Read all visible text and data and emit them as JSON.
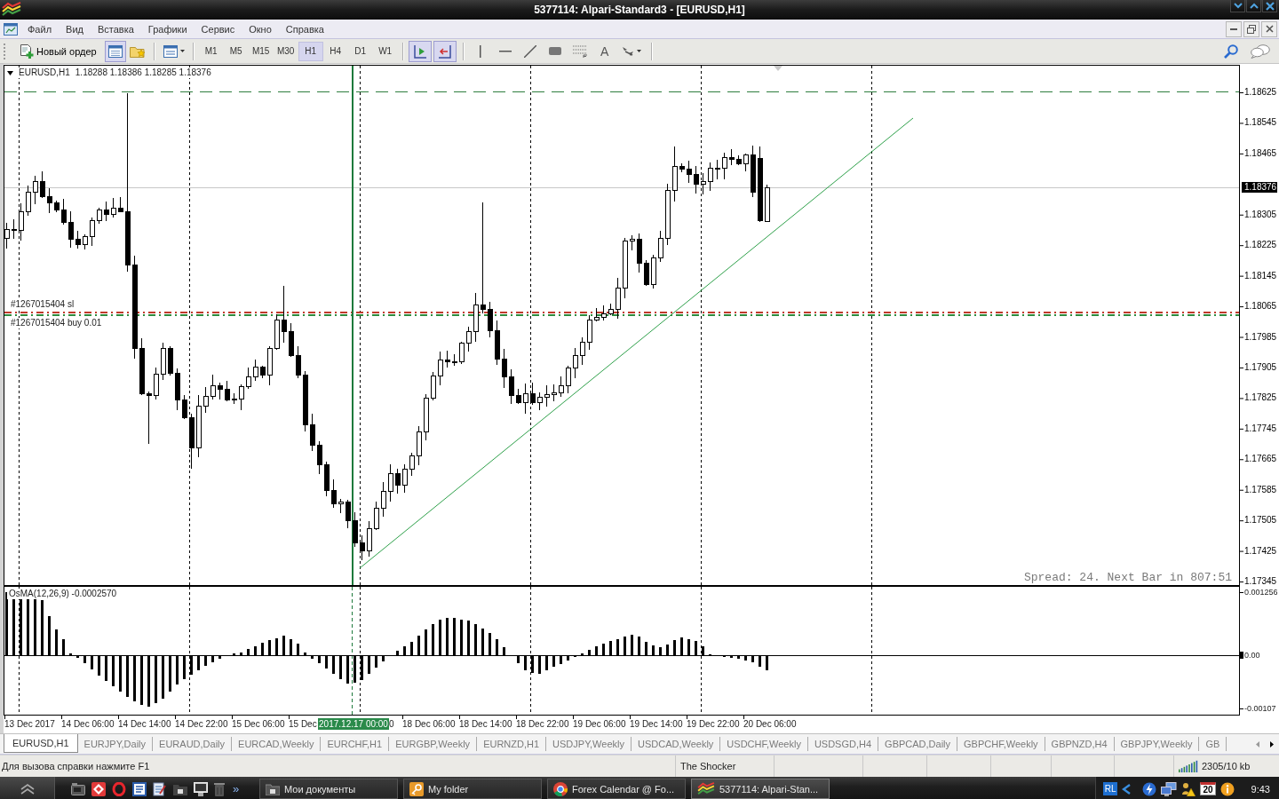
{
  "window": {
    "title": "5377114: Alpari-Standard3 - [EURUSD,H1]"
  },
  "menu": [
    "Файл",
    "Вид",
    "Вставка",
    "Графики",
    "Сервис",
    "Окно",
    "Справка"
  ],
  "toolbar": {
    "new_order": "Новый ордер",
    "buttons": [
      {
        "kind": "list",
        "on": true
      },
      {
        "kind": "favorites",
        "on": false
      },
      {
        "kind": "template",
        "on": false
      }
    ],
    "timeframes": [
      {
        "label": "M1",
        "selected": false
      },
      {
        "label": "M5",
        "selected": false
      },
      {
        "label": "M15",
        "selected": false
      },
      {
        "label": "M30",
        "selected": false
      },
      {
        "label": "H1",
        "selected": true
      },
      {
        "label": "H4",
        "selected": false
      },
      {
        "label": "D1",
        "selected": false
      },
      {
        "label": "W1",
        "selected": false
      }
    ],
    "toggles": [
      {
        "kind": "shift",
        "on": true
      },
      {
        "kind": "autoscroll",
        "on": true
      }
    ],
    "tools": [
      {
        "kind": "vline"
      },
      {
        "kind": "hline"
      },
      {
        "kind": "trendline"
      },
      {
        "kind": "rectangle"
      },
      {
        "kind": "fibo"
      },
      {
        "kind": "text",
        "label": "A"
      },
      {
        "kind": "arrows"
      }
    ]
  },
  "chart": {
    "symbol": "EURUSD,H1",
    "ohlc": "1.18288 1.18386 1.18285 1.18376",
    "orders": [
      {
        "label": "#1267015404 sl",
        "color": "#c0392b"
      },
      {
        "label": "#1267015404 buy 0.01",
        "color": "#2e8b3e"
      }
    ],
    "price_labels": [
      "1.18625",
      "1.18545",
      "1.18465",
      "1.18305",
      "1.18225",
      "1.18145",
      "1.18065",
      "1.17985",
      "1.17905",
      "1.17825",
      "1.17745",
      "1.17665",
      "1.17585",
      "1.17505",
      "1.17425",
      "1.17345"
    ],
    "current_price": "1.18376",
    "info": "Spread: 24. Next Bar in 807:51"
  },
  "indicator": {
    "label": "OsMA(12,26,9) -0.0002570",
    "axis_labels": [
      "0.001256",
      "0.00",
      "-0.00107"
    ]
  },
  "time_axis": {
    "labels": [
      "13 Dec 2017",
      "14 Dec 06:00",
      "14 Dec 14:00",
      "14 Dec 22:00",
      "15 Dec 06:00",
      "15 Dec"
    ],
    "cursor": "2017.12.17 00:00",
    "cut_label": "0",
    "labels_right": [
      "18 Dec 06:00",
      "18 Dec 14:00",
      "18 Dec 22:00",
      "19 Dec 06:00",
      "19 Dec 14:00",
      "19 Dec 22:00",
      "20 Dec 06:00"
    ]
  },
  "tabs": [
    {
      "label": "EURUSD,H1",
      "selected": true
    },
    {
      "label": "EURJPY,Daily",
      "selected": false
    },
    {
      "label": "EURAUD,Daily",
      "selected": false
    },
    {
      "label": "EURCAD,Weekly",
      "selected": false
    },
    {
      "label": "EURCHF,H1",
      "selected": false
    },
    {
      "label": "EURGBP,Weekly",
      "selected": false
    },
    {
      "label": "EURNZD,H1",
      "selected": false
    },
    {
      "label": "USDJPY,Weekly",
      "selected": false
    },
    {
      "label": "USDCAD,Weekly",
      "selected": false
    },
    {
      "label": "USDCHF,Weekly",
      "selected": false
    },
    {
      "label": "USDSGD,H4",
      "selected": false
    },
    {
      "label": "GBPCAD,Daily",
      "selected": false
    },
    {
      "label": "GBPCHF,Weekly",
      "selected": false
    },
    {
      "label": "GBPNZD,H4",
      "selected": false
    },
    {
      "label": "GBPJPY,Weekly",
      "selected": false
    },
    {
      "label": "GB",
      "selected": false
    }
  ],
  "status_bar": {
    "help": "Для вызова справки нажмите F1",
    "profile": "The Shocker",
    "traffic": "2305/10 kb"
  },
  "taskbar": {
    "more": "»",
    "tasks": [
      {
        "label": "Мои документы",
        "kind": "folder",
        "selected": false
      },
      {
        "label": "My folder",
        "kind": "key",
        "selected": false
      },
      {
        "label": "Forex Calendar @ Fo...",
        "kind": "browser",
        "selected": false
      },
      {
        "label": "5377114: Alpari-Stan...",
        "kind": "terminal",
        "selected": true
      }
    ],
    "language": "RL",
    "calendar_day": "20",
    "time": "9:43"
  }
}
